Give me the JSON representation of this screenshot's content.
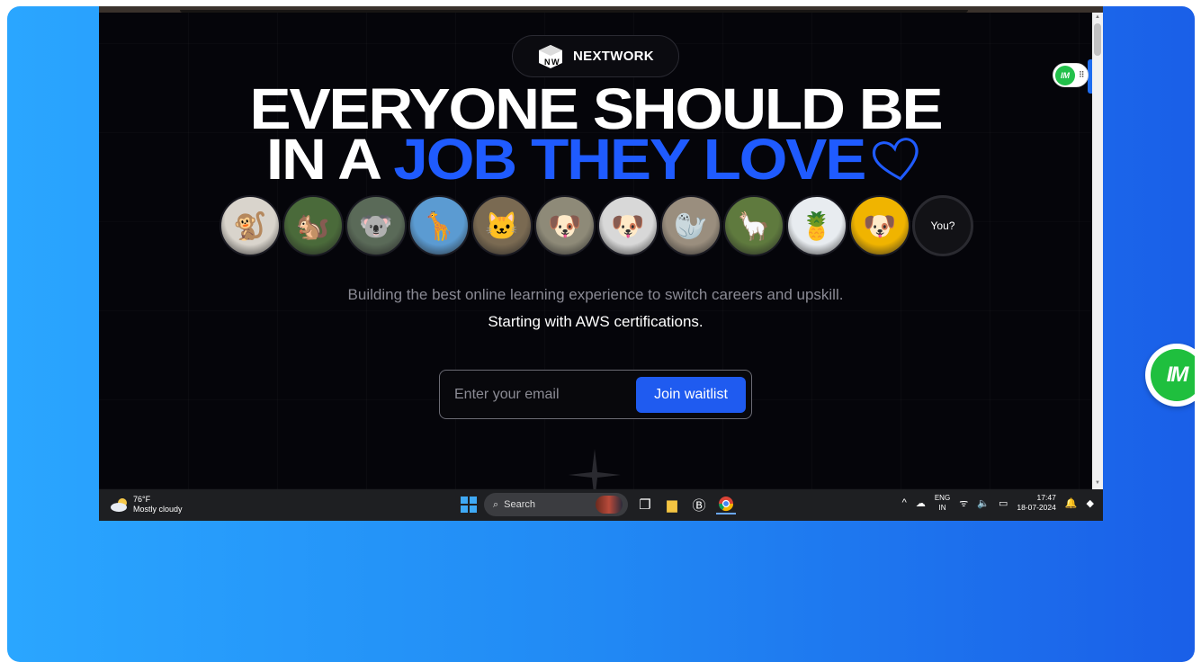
{
  "brand": {
    "name": "NEXTWORK",
    "logo_text": "NW"
  },
  "headline": {
    "line1": "EVERYONE SHOULD BE",
    "line2_white": "IN A ",
    "line2_blue": "JOB THEY LOVE"
  },
  "avatars": [
    {
      "name": "white-monkey",
      "glyph": "🐒",
      "bg": "#d9d4cc"
    },
    {
      "name": "squirrel",
      "glyph": "🐿️",
      "bg": "#4a6a3a"
    },
    {
      "name": "koala",
      "glyph": "🐨",
      "bg": "#5a6a58"
    },
    {
      "name": "giraffe",
      "glyph": "🦒",
      "bg": "#5b9bd2"
    },
    {
      "name": "cat",
      "glyph": "🐱",
      "bg": "#7a6a52"
    },
    {
      "name": "pug-blanket",
      "glyph": "🐶",
      "bg": "#8e8a78"
    },
    {
      "name": "pug-glasses",
      "glyph": "🐶",
      "bg": "#d8d8d8"
    },
    {
      "name": "seal",
      "glyph": "🦭",
      "bg": "#9a8e7e"
    },
    {
      "name": "llama",
      "glyph": "🦙",
      "bg": "#5f7a3e"
    },
    {
      "name": "pineapple",
      "glyph": "🍍",
      "bg": "#e8ecf0"
    },
    {
      "name": "pug-yellow",
      "glyph": "🐶",
      "bg": "#f0b400"
    }
  ],
  "you_label": "You?",
  "subtitle1": "Building the best online learning experience to switch careers and upskill.",
  "subtitle2": "Starting with AWS certifications.",
  "form": {
    "placeholder": "Enter your email",
    "button": "Join waitlist"
  },
  "extension": {
    "badge_text": "IM"
  },
  "taskbar": {
    "weather_temp": "76°F",
    "weather_desc": "Mostly cloudy",
    "search_label": "Search",
    "lang_top": "ENG",
    "lang_bottom": "IN",
    "time": "17:47",
    "date": "18-07-2024"
  },
  "colors": {
    "accent_blue": "#1f5bff",
    "button_blue": "#1f5bf0",
    "ext_green": "#1fbf3e"
  }
}
